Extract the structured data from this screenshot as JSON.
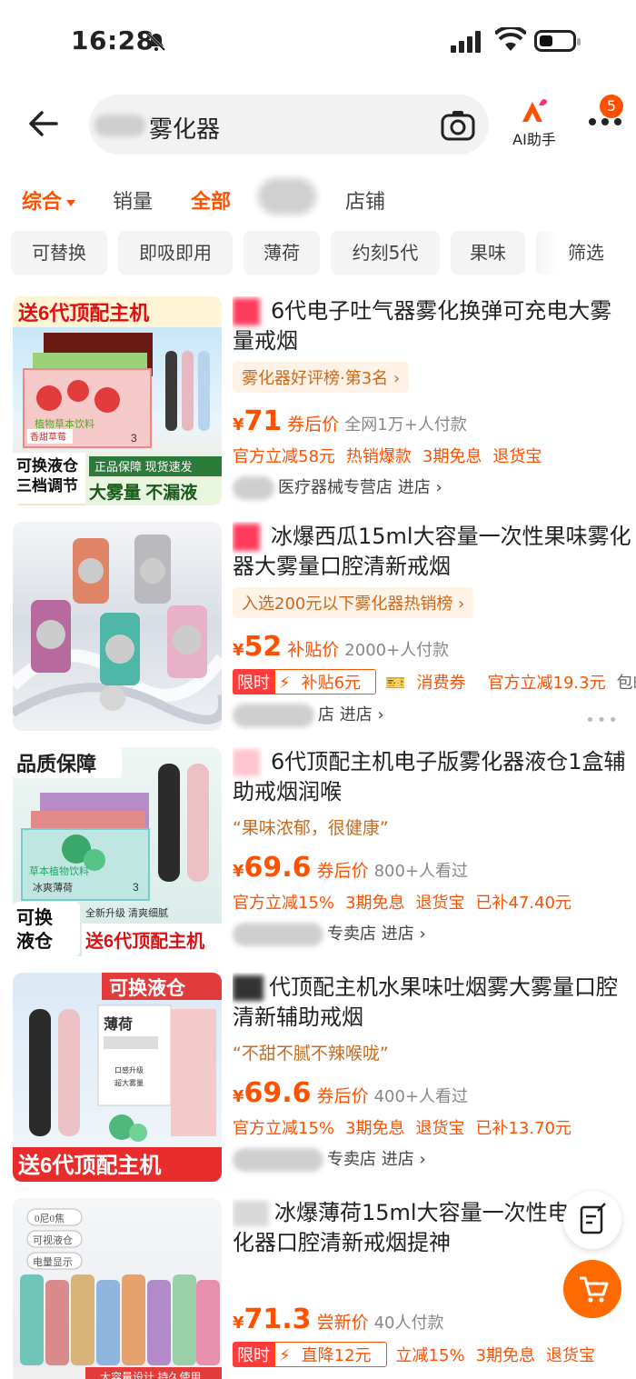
{
  "status": {
    "time": "16:28"
  },
  "search": {
    "query": "雾化器",
    "ai_label": "AI助手",
    "badge": "5"
  },
  "sort": {
    "comprehensive": "综合",
    "sales": "销量",
    "all": "全部",
    "store": "店铺"
  },
  "filters": [
    "可替换",
    "即吸即用",
    "薄荷",
    "约刻5代",
    "果味",
    "筛选"
  ],
  "products": [
    {
      "title": "6代电子吐气器雾化换弹可充电大雾量戒烟",
      "rank": "雾化器好评榜·第3名 ›",
      "yen": "¥",
      "price": "71",
      "price_label": "券后价",
      "sales": "全网1万+人付款",
      "promos": [
        "官方立减58元",
        "热销爆款",
        "3期免息",
        "退货宝"
      ],
      "shop": "医疗器械专营店",
      "shop_link": "进店 ›",
      "img": {
        "banner": "送6代顶配主机",
        "b1": "可换液仓",
        "b2": "三档调节",
        "b3": "正品保障 现货速发",
        "b4": "大雾量 不漏液",
        "box": "植物草本饮料",
        "flavor": "香甜草莓",
        "count": "3"
      }
    },
    {
      "title": "冰爆西瓜15ml大容量一次性果味雾化器大雾量口腔清新戒烟",
      "rank": "入选200元以下雾化器热销榜 ›",
      "yen": "¥",
      "price": "52",
      "price_label": "补贴价",
      "sales": "2000+人付款",
      "limit": "限时",
      "subsidy": "补贴6元",
      "coupon": "消费券",
      "promos": [
        "官方立减19.3元",
        "包邮"
      ],
      "shop": "店",
      "shop_link": "进店 ›"
    },
    {
      "title": "6代顶配主机电子版雾化器液仓1盒辅助戒烟润喉",
      "quote": "“果味浓郁，很健康”",
      "yen": "¥",
      "price": "69.6",
      "price_label": "券后价",
      "sales": "800+人看过",
      "promos": [
        "官方立减15%",
        "3期免息",
        "退货宝",
        "已补47.40元"
      ],
      "shop": "专卖店",
      "shop_link": "进店 ›",
      "img": {
        "top": "品质保障",
        "box": "草本植物饮料",
        "flavor": "冰爽薄荷",
        "count": "3",
        "b1": "可换",
        "b2": "液仓",
        "upg": "全新升级 清爽细腻",
        "banner": "送6代顶配主机"
      }
    },
    {
      "title": "代顶配主机水果味吐烟雾大雾量口腔清新辅助戒烟",
      "quote": "“不甜不腻不辣喉咙”",
      "yen": "¥",
      "price": "69.6",
      "price_label": "券后价",
      "sales": "400+人看过",
      "promos": [
        "官方立减15%",
        "3期免息",
        "退货宝",
        "已补13.70元"
      ],
      "shop": "专卖店",
      "shop_link": "进店 ›",
      "img": {
        "top": "可换液仓",
        "box": "薄荷",
        "f1": "口感升级",
        "f2": "超大雾量",
        "banner": "送6代顶配主机"
      }
    },
    {
      "title": "冰爆薄荷15ml大容量一次性电子雾化器口腔清新戒烟提神",
      "yen": "¥",
      "price": "71.3",
      "price_label": "尝新价",
      "sales": "40人付款",
      "limit": "限时",
      "subsidy": "直降12元",
      "promos": [
        "立减15%",
        "3期免息",
        "退货宝"
      ],
      "img": {
        "l1": "0尼0焦",
        "l2": "可视液仓",
        "l3": "电量显示",
        "bottom": "大容量设计 持久使用"
      }
    }
  ]
}
